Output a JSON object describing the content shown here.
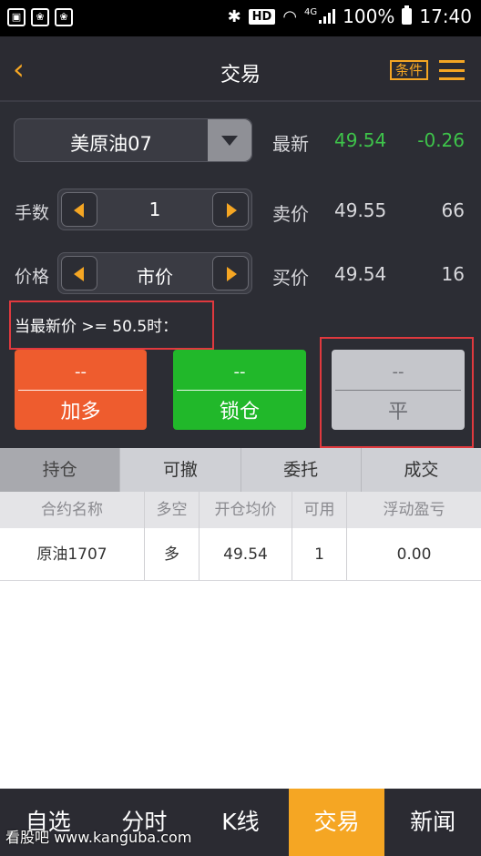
{
  "status": {
    "hd": "HD",
    "net": "4G",
    "battery_pct": "100%",
    "time": "17:40"
  },
  "header": {
    "title": "交易",
    "condition_label": "条件"
  },
  "contract": {
    "name": "美原油07"
  },
  "quote": {
    "latest_label": "最新",
    "latest_price": "49.54",
    "latest_change": "-0.26",
    "sell_label": "卖价",
    "sell_price": "49.55",
    "sell_qty": "66",
    "buy_label": "买价",
    "buy_price": "49.54",
    "buy_qty": "16"
  },
  "qty": {
    "label": "手数",
    "value": "1"
  },
  "price": {
    "label": "价格",
    "value": "市价"
  },
  "condition_text": "当最新价 >= 50.5时：",
  "buttons": {
    "long": {
      "top": "--",
      "label": "加多"
    },
    "lock": {
      "top": "--",
      "label": "锁仓"
    },
    "flat": {
      "top": "--",
      "label": "平"
    }
  },
  "tabs": [
    "持仓",
    "可撤",
    "委托",
    "成交"
  ],
  "table": {
    "headers": [
      "合约名称",
      "多空",
      "开仓均价",
      "可用",
      "浮动盈亏"
    ],
    "rows": [
      [
        "原油1707",
        "多",
        "49.54",
        "1",
        "0.00"
      ]
    ]
  },
  "nav": [
    "自选",
    "分时",
    "K线",
    "交易",
    "新闻"
  ],
  "watermark": "看股吧 www.kanguba.com",
  "colors": {
    "accent": "#f5a623",
    "up": "#3ec34a",
    "long": "#ee5c2e",
    "lock": "#21b82a"
  }
}
